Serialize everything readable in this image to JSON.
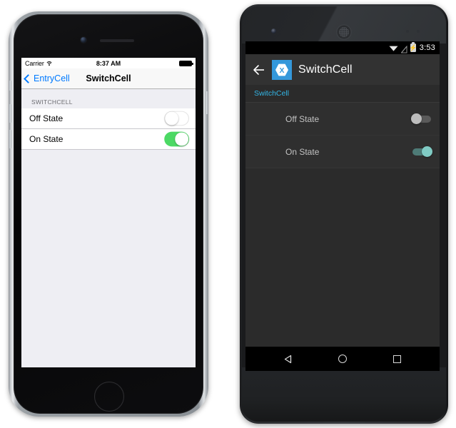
{
  "ios": {
    "status_bar": {
      "carrier": "Carrier",
      "wifi_icon": "wifi-icon",
      "time": "8:37 AM",
      "battery_icon": "battery-full-icon"
    },
    "nav_bar": {
      "back_icon": "chevron-left-icon",
      "back_label": "EntryCell",
      "title": "SwitchCell"
    },
    "section_header": "SWITCHCELL",
    "cells": [
      {
        "label": "Off State",
        "state": "off"
      },
      {
        "label": "On State",
        "state": "on"
      }
    ],
    "colors": {
      "accent_blue": "#007aff",
      "switch_on_green": "#4cd964",
      "table_background": "#eeeef3",
      "cell_background": "#ffffff",
      "separator": "#c8c7cc",
      "header_text": "#6d6d72"
    }
  },
  "android": {
    "status_bar": {
      "wifi_icon": "wifi-icon",
      "signal_off_icon": "signal-no-service-icon",
      "battery_icon": "battery-charging-icon",
      "time": "3:53"
    },
    "action_bar": {
      "back_icon": "arrow-left-icon",
      "app_logo": "xamarin-logo-icon",
      "title": "SwitchCell"
    },
    "section_header": "SwitchCell",
    "rows": [
      {
        "label": "Off State",
        "state": "off"
      },
      {
        "label": "On State",
        "state": "on"
      }
    ],
    "nav_bar": {
      "back_icon": "nav-back-triangle-icon",
      "home_icon": "nav-home-circle-icon",
      "recents_icon": "nav-recents-square-icon"
    },
    "colors": {
      "accent_blue": "#33b5e5",
      "action_bar": "#323232",
      "logo_blue": "#3498db",
      "switch_on_thumb": "#80cbc4",
      "switch_on_track": "#4e7b77",
      "switch_off_thumb": "#bdbdbd",
      "row_background": "#2f2f2f",
      "label_text": "#c2c2c2"
    }
  }
}
